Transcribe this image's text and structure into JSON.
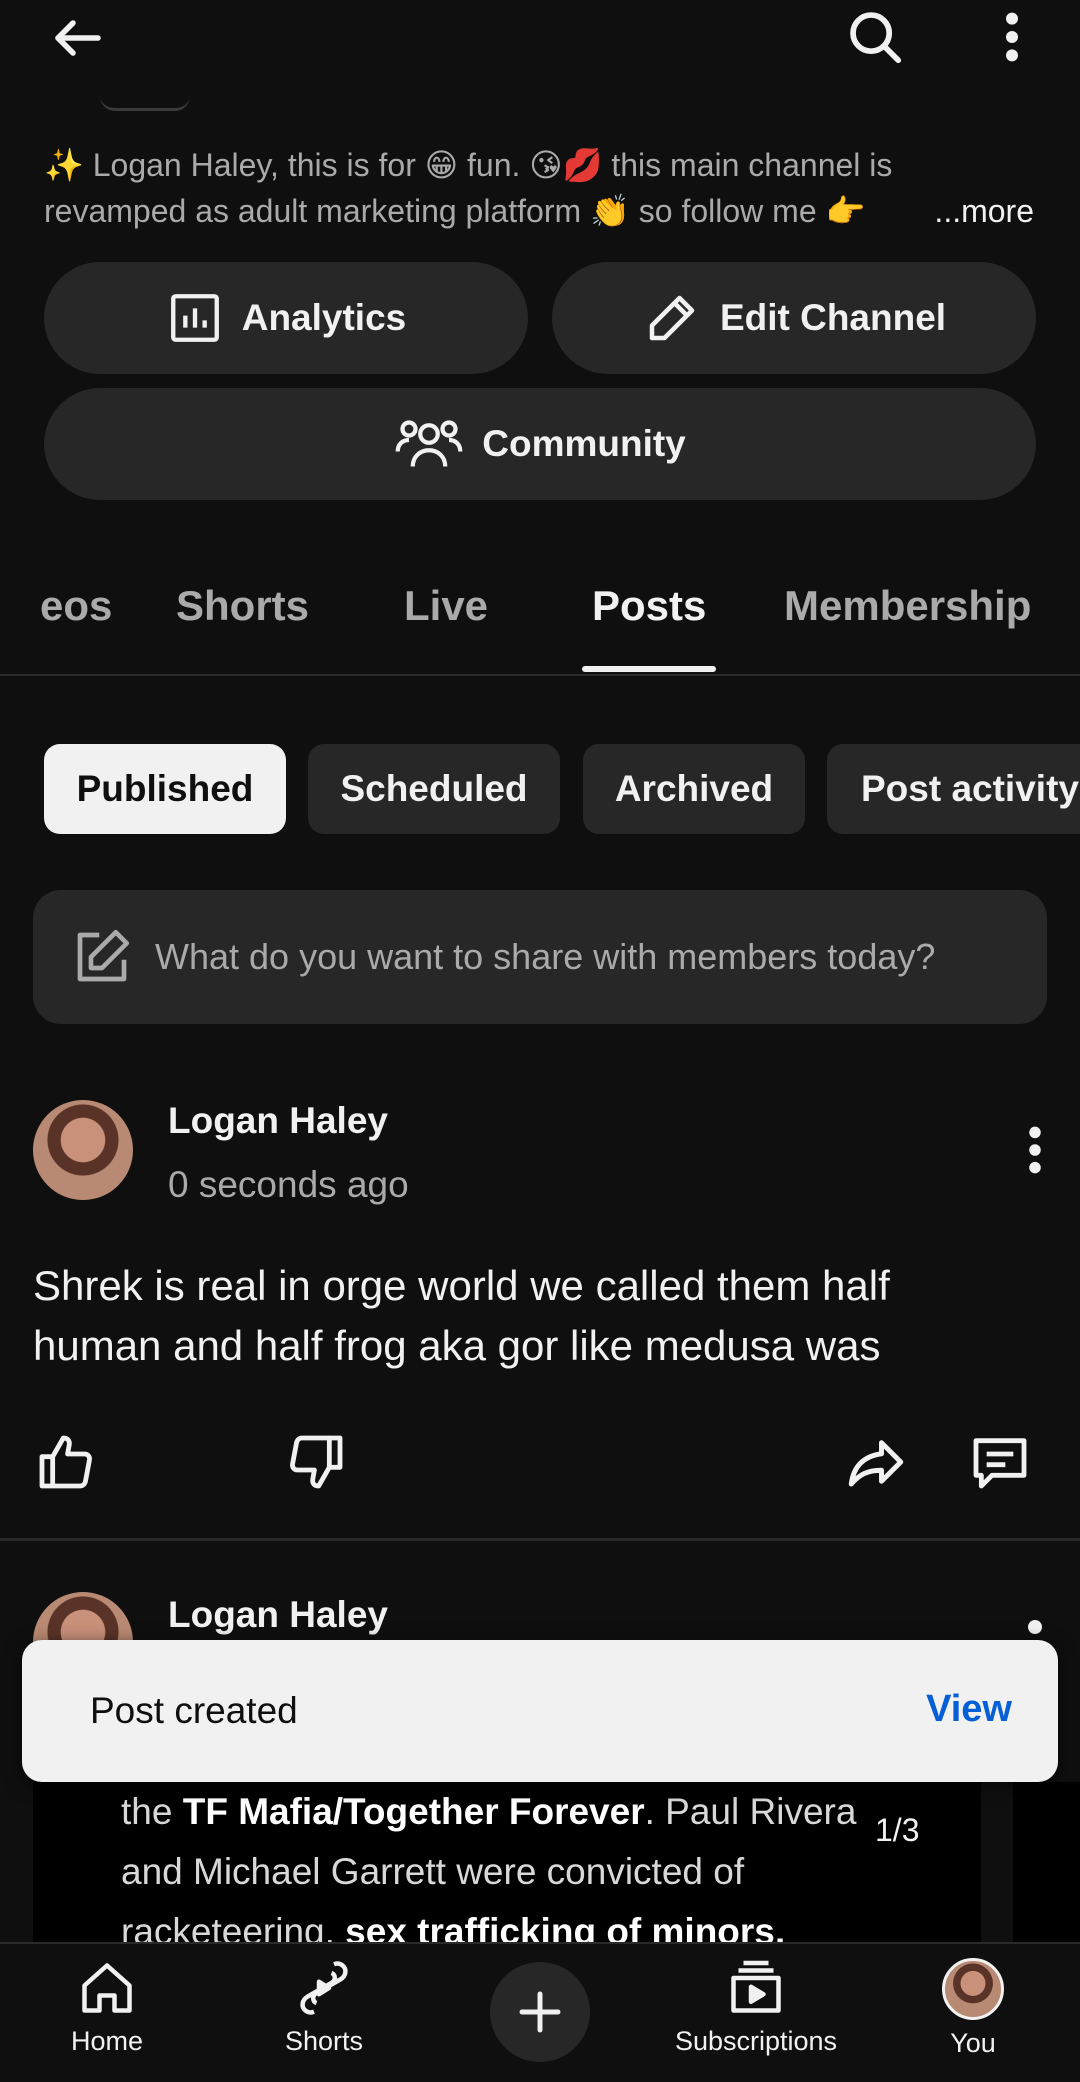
{
  "channel": {
    "description_line1": "✨ Logan Haley, this is for 😁 fun. 😘💋 this main channel is",
    "description_line2": "revamped as adult marketing platform 👏 so follow me 👉",
    "more_label": "...more"
  },
  "actions": {
    "analytics_label": "Analytics",
    "edit_label": "Edit Channel",
    "community_label": "Community"
  },
  "tabs": [
    "eos",
    "Shorts",
    "Live",
    "Posts",
    "Membership"
  ],
  "active_tab": "Posts",
  "filters": [
    "Published",
    "Scheduled",
    "Archived",
    "Post activity"
  ],
  "active_filter": "Published",
  "compose": {
    "placeholder": "What do you want to share with members today?"
  },
  "posts": [
    {
      "author": "Logan Haley",
      "time": "0 seconds ago",
      "text_line1": "Shrek is real in orge world we called them half",
      "text_line2": "human and half frog aka gor like medusa was"
    },
    {
      "author": "Logan Haley",
      "image_text": {
        "line1_a": "the ",
        "line1_b": "TF Mafia/Together Forever",
        "line1_c": ". Paul Rivera",
        "line2": "and Michael Garrett were convicted of",
        "line3_a": "racketeering, ",
        "line3_b": "sex trafficking of minors,"
      },
      "image_counter": "1/3"
    }
  ],
  "toast": {
    "message": "Post created",
    "action": "View"
  },
  "bottom_nav": {
    "home": "Home",
    "shorts": "Shorts",
    "subscriptions": "Subscriptions",
    "you": "You"
  },
  "colors": {
    "background": "#0f0f0f",
    "surface": "#272727",
    "link": "#065fd4"
  }
}
